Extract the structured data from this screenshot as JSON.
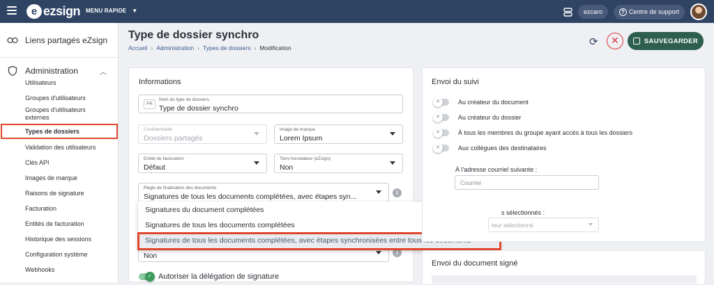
{
  "topbar": {
    "logo": "ezsign",
    "menu_rapide": "MENU RAPIDE",
    "user": "ezcaro",
    "support": "Centre de support"
  },
  "sidebar": {
    "liens": "Liens partagés eZsign",
    "admin": "Administration",
    "items": [
      "Utilisateurs",
      "Groupes d'utilisateurs",
      "Groupes d'utilisateurs externes",
      "Types de dossiers",
      "Validation des utilisateurs",
      "Clés API",
      "Images de marque",
      "Raisons de signature",
      "Facturation",
      "Entités de facturation",
      "Historique des sessions",
      "Configuration système",
      "Webhooks"
    ]
  },
  "header": {
    "title": "Type de dossier synchro",
    "breadcrumb": [
      "Accueil",
      "Administration",
      "Types de dossiers",
      "Modification"
    ],
    "save": "SAUVEGARDER"
  },
  "informations": {
    "title": "Informations",
    "lang": "FR",
    "nom": {
      "label": "Nom du type de dossiers",
      "value": "Type de dossier synchro"
    },
    "confidentialite": {
      "label": "Confidentialité",
      "value": "Dossiers partagés"
    },
    "image_marque": {
      "label": "Image de marque",
      "value": "Lorem Ipsum"
    },
    "entite": {
      "label": "Entité de facturation",
      "value": "Défaut"
    },
    "tiers": {
      "label": "Tiers horodateur (eZsign)",
      "value": "Non"
    },
    "regle": {
      "label": "Règle de finalisation des documents",
      "value": "Signatures de tous les documents complétées, avec étapes syn..."
    },
    "next_value": "Non",
    "delegation": "Autoriser la délégation de signature"
  },
  "dropdown": {
    "options": [
      "Signatures du document complétées",
      "Signatures de tous les documents complétées",
      "Signatures de tous les documents complétées, avec étapes synchronisées entre tous les documents"
    ]
  },
  "suivi": {
    "title": "Envoi du suivi",
    "toggles": [
      "Au créateur du document",
      "Au créateur du dossier",
      "À tous les membres du groupe ayant accès à tous les dossiers",
      "Aux collègues des destinataires"
    ],
    "adresse_label": "À l'adresse courriel suivante :",
    "courriel_placeholder": "Courriel",
    "selectionnes_label": "s sélectionnés :",
    "selectionne_value": "teur sélectionné"
  },
  "document_signe": {
    "title": "Envoi du document signé"
  }
}
